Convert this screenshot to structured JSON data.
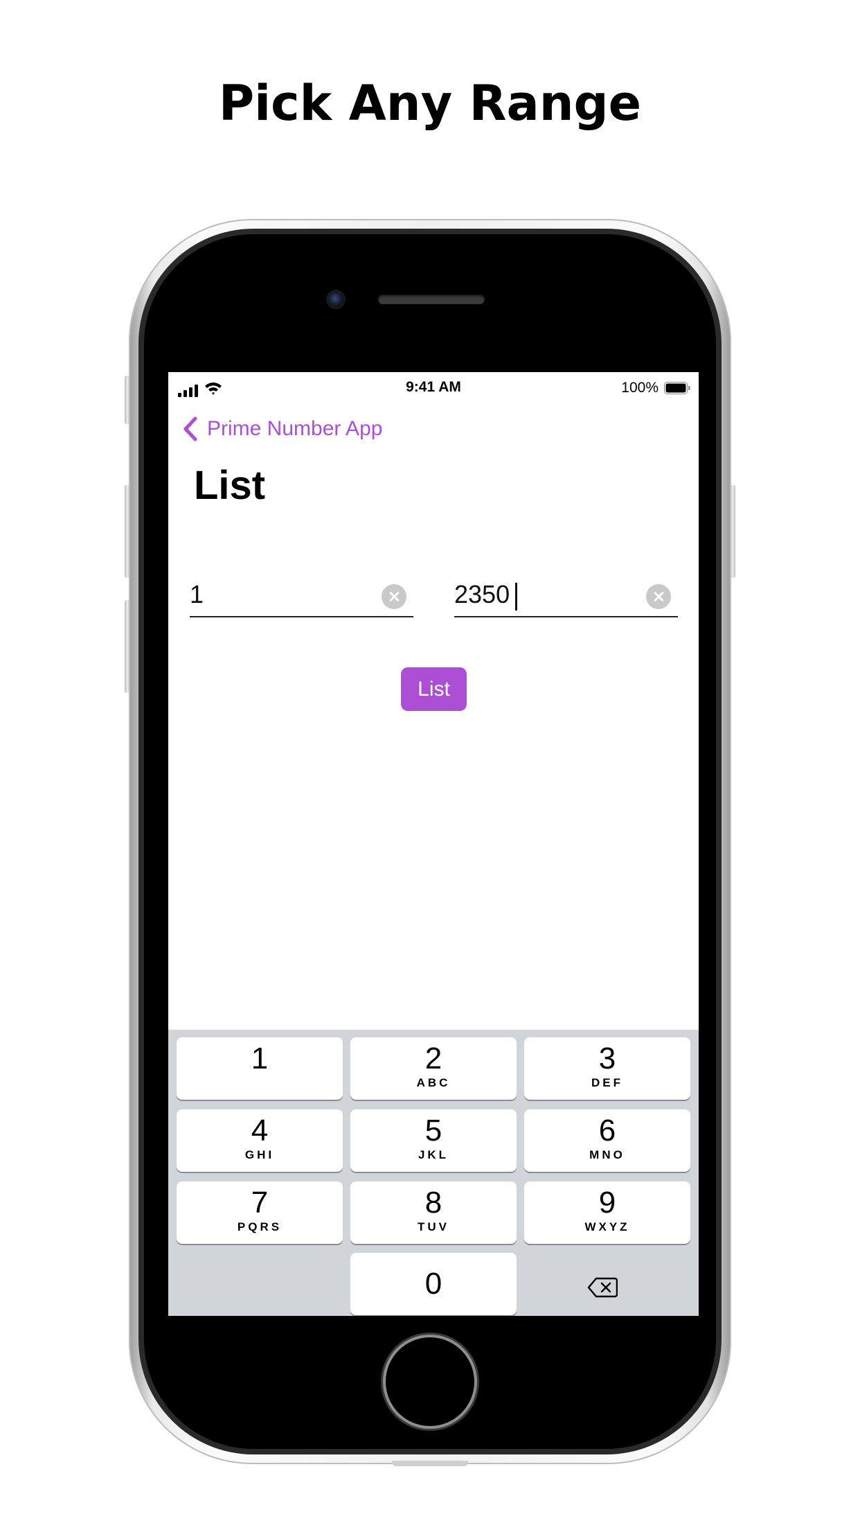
{
  "headline": "Pick Any Range",
  "status_bar": {
    "time": "9:41 AM",
    "battery_percent": "100%",
    "icons": [
      "cellular-signal-icon",
      "wifi-icon",
      "battery-icon"
    ]
  },
  "nav": {
    "back_label": "Prime Number App",
    "back_icon": "chevron-left-icon",
    "title": "List"
  },
  "range": {
    "start_value": "1",
    "end_value": "2350"
  },
  "list_button_label": "List",
  "keypad": {
    "keys": [
      {
        "digit": "1",
        "letters": ""
      },
      {
        "digit": "2",
        "letters": "ABC"
      },
      {
        "digit": "3",
        "letters": "DEF"
      },
      {
        "digit": "4",
        "letters": "GHI"
      },
      {
        "digit": "5",
        "letters": "JKL"
      },
      {
        "digit": "6",
        "letters": "MNO"
      },
      {
        "digit": "7",
        "letters": "PQRS"
      },
      {
        "digit": "8",
        "letters": "TUV"
      },
      {
        "digit": "9",
        "letters": "WXYZ"
      },
      {
        "digit": "0",
        "letters": ""
      }
    ],
    "delete_icon": "backspace-icon"
  },
  "colors": {
    "accent": "#ad4fd4",
    "keypad_background": "#d1d4d9"
  }
}
